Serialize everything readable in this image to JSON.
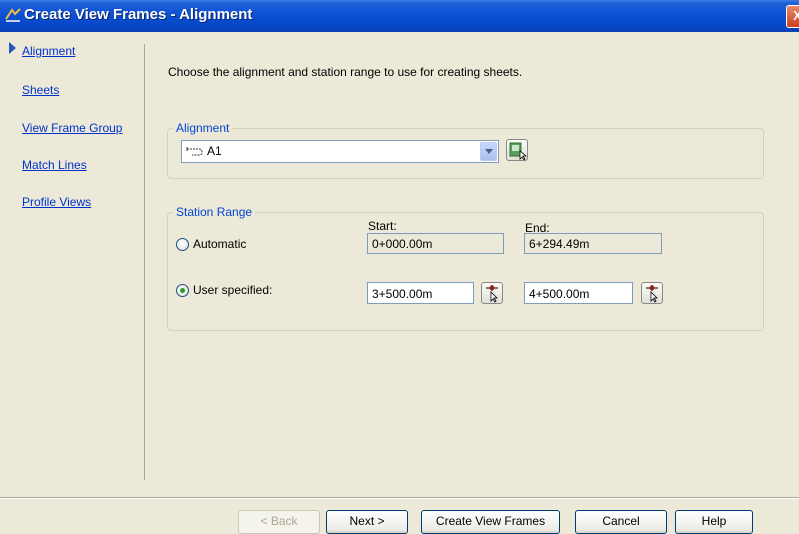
{
  "window": {
    "title": "Create View Frames - Alignment",
    "close_glyph": "X"
  },
  "nav": {
    "items": [
      {
        "label": "Alignment",
        "active": true
      },
      {
        "label": "Sheets"
      },
      {
        "label": "View Frame Group"
      },
      {
        "label": "Match Lines"
      },
      {
        "label": "Profile Views"
      }
    ]
  },
  "main": {
    "instruction": "Choose the alignment and station range to use for creating sheets.",
    "alignment_group": {
      "legend": "Alignment",
      "selected": "A1",
      "icons": {
        "item": "alignment-icon",
        "pick": "pick-from-drawing-icon"
      }
    },
    "station_range": {
      "legend": "Station Range",
      "start_label": "Start:",
      "end_label": "End:",
      "automatic": {
        "label": "Automatic",
        "selected": false,
        "start": "0+000.00m",
        "end": "6+294.49m"
      },
      "user_specified": {
        "label": "User specified:",
        "selected": true,
        "start": "3+500.00m",
        "end": "4+500.00m"
      }
    }
  },
  "buttons": {
    "back": "< Back",
    "next": "Next >",
    "create": "Create View Frames",
    "cancel": "Cancel",
    "help": "Help"
  },
  "colors": {
    "title_bar": "#0a4fd3",
    "link": "#0033cc",
    "legend": "#0046d5",
    "dialog_bg": "#ece9d8"
  }
}
